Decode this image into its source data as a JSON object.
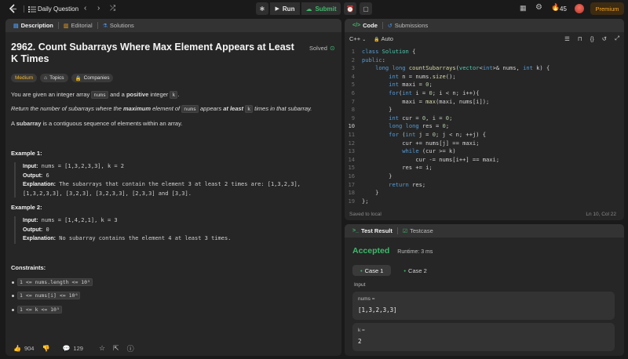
{
  "topbar": {
    "problem_list_label": "Daily Question",
    "run_label": "Run",
    "submit_label": "Submit",
    "streak_count": "45",
    "premium_label": "Premium"
  },
  "left_tabs": [
    "Description",
    "Editorial",
    "Solutions"
  ],
  "problem": {
    "title": "2962. Count Subarrays Where Max Element Appears at Least K Times",
    "status": "Solved",
    "difficulty": "Medium",
    "topics_label": "Topics",
    "companies_label": "Companies",
    "intro_1": "You are given an integer array",
    "intro_nums": "nums",
    "intro_2": "and a",
    "intro_positive": "positive",
    "intro_3": "integer",
    "intro_k": "k",
    "intro_end": ".",
    "ret_1": "Return the number of subarrays where the",
    "ret_max": "maximum",
    "ret_2": "element of",
    "ret_nums": "nums",
    "ret_3": "appears",
    "ret_atleast": "at least",
    "ret_k": "k",
    "ret_4": "times in that subarray.",
    "sub_bold": "subarray",
    "sub_pre": "A",
    "sub_rest": "is a contiguous sequence of elements within an array.",
    "example1_title": "Example 1:",
    "example1_input_label": "Input:",
    "example1_input": "nums = [1,3,2,3,3], k = 2",
    "example1_output_label": "Output:",
    "example1_output": "6",
    "example1_expl_label": "Explanation:",
    "example1_expl_1": "The subarrays that contain the element 3 at least 2 times are: [1,3,2,3],",
    "example1_expl_2": "[1,3,2,3,3], [3,2,3], [3,2,3,3], [2,3,3] and [3,3].",
    "example2_title": "Example 2:",
    "example2_input_label": "Input:",
    "example2_input": "nums = [1,4,2,1], k = 3",
    "example2_output_label": "Output:",
    "example2_output": "0",
    "example2_expl_label": "Explanation:",
    "example2_expl": "No subarray contains the element 4 at least 3 times.",
    "constraints_title": "Constraints:",
    "constraints": [
      "1 <= nums.length <= 10⁵",
      "1 <= nums[i] <= 10⁶",
      "1 <= k <= 10⁵"
    ],
    "likes": "904",
    "comments": "129"
  },
  "code_tabs": [
    "Code",
    "Submissions"
  ],
  "editor": {
    "language": "C++",
    "mode": "Auto",
    "saved": "Saved to local",
    "cursor": "Ln 10, Col 22",
    "lines": [
      "class Solution {",
      "public:",
      "    long long countSubarrays(vector<int>& nums, int k) {",
      "        int n = nums.size();",
      "        int maxi = 0;",
      "        for(int i = 0; i < n; i++){",
      "            maxi = max(maxi, nums[i]);",
      "        }",
      "        int cur = 0, i = 0;",
      "        long long res = 0;",
      "        for (int j = 0; j < n; ++j) {",
      "            cur += nums[j] == maxi;",
      "            while (cur >= k)",
      "                cur -= nums[i++] == maxi;",
      "            res += i;",
      "        }",
      "        return res;",
      "    }",
      "};"
    ]
  },
  "result_tabs": [
    "Test Result",
    "Testcase"
  ],
  "result": {
    "status": "Accepted",
    "runtime": "Runtime: 3 ms",
    "case1": "Case 1",
    "case2": "Case 2",
    "input_label": "Input",
    "param1_name": "nums =",
    "param1_value": "[1,3,2,3,3]",
    "param2_name": "k =",
    "param2_value": "2"
  }
}
